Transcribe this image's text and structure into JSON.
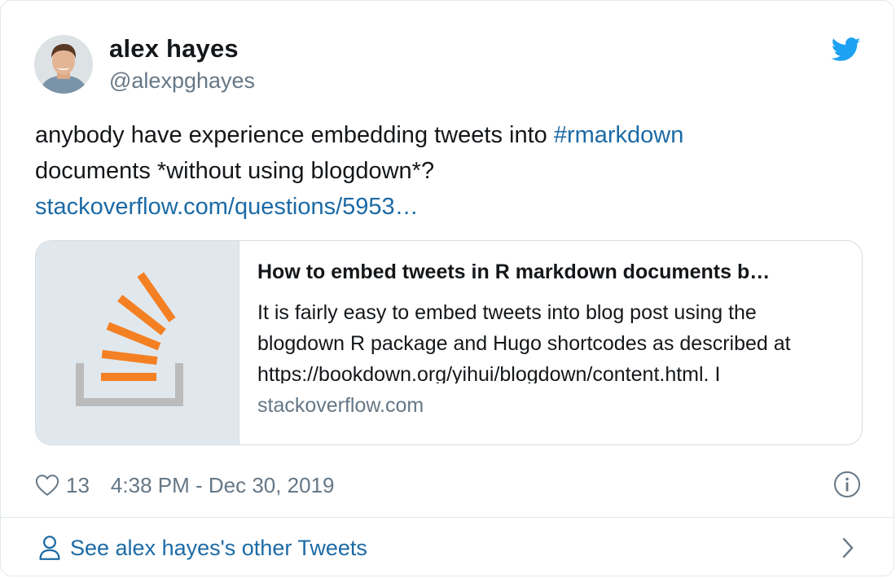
{
  "author": {
    "name": "alex hayes",
    "handle": "@alexpghayes"
  },
  "tweet": {
    "text_line1_prefix": "anybody have experience embedding tweets into ",
    "hashtag": "#rmarkdown",
    "text_line2": "documents *without using blogdown*?",
    "link": "stackoverflow.com/questions/5953…"
  },
  "card": {
    "title": "How to embed tweets in R markdown documents b…",
    "description": "It is fairly easy to embed tweets into blog post using the blogdown R package and Hugo shortcodes as described at https://bookdown.org/yihui/blogdown/content.html. I",
    "domain": "stackoverflow.com",
    "thumbnail_icon": "stackoverflow-logo"
  },
  "meta": {
    "like_count": "13",
    "timestamp": "4:38 PM - Dec 30, 2019"
  },
  "footer": {
    "see_more": "See alex hayes's other Tweets"
  },
  "colors": {
    "link_blue": "#1b6aa5",
    "twitter_blue": "#1da1f2",
    "so_orange": "#f48024",
    "so_gray": "#bcbbbb",
    "muted_text": "#657786"
  }
}
